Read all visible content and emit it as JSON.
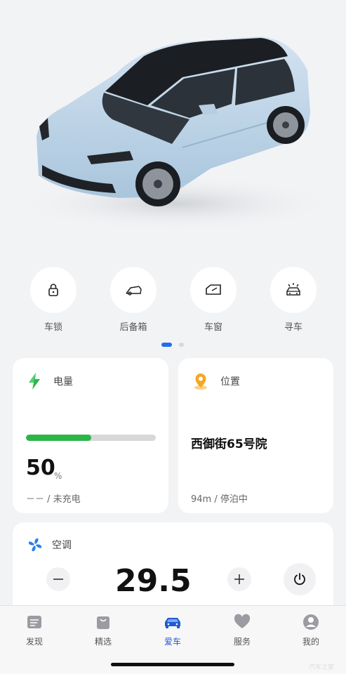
{
  "quick_actions": [
    {
      "label": "车锁",
      "icon": "lock-icon"
    },
    {
      "label": "后备箱",
      "icon": "trunk-icon"
    },
    {
      "label": "车窗",
      "icon": "window-icon"
    },
    {
      "label": "寻车",
      "icon": "find-car-icon"
    }
  ],
  "pager": {
    "count": 2,
    "active": 0
  },
  "battery": {
    "title": "电量",
    "percent": "50",
    "unit": "%",
    "level": 0.5,
    "status": "－－ / 未充电",
    "icon": "lightning-icon",
    "bar_color": "#2db54a"
  },
  "location": {
    "title": "位置",
    "address": "西御街65号院",
    "status": "94m / 停泊中",
    "icon": "location-pin-icon"
  },
  "ac": {
    "title": "空调",
    "temperature": "29.5",
    "icon": "fan-icon"
  },
  "tabs": [
    {
      "label": "发现",
      "icon": "discover-icon",
      "active": false
    },
    {
      "label": "精选",
      "icon": "shopping-bag-icon",
      "active": false
    },
    {
      "label": "爱车",
      "icon": "car-icon",
      "active": true
    },
    {
      "label": "服务",
      "icon": "heart-icon",
      "active": false
    },
    {
      "label": "我的",
      "icon": "profile-icon",
      "active": false
    }
  ],
  "watermark": "汽车之家",
  "colors": {
    "accent": "#1f6feb",
    "background": "#f2f3f5",
    "card": "#ffffff",
    "active_tab": "#1f5ad1"
  }
}
